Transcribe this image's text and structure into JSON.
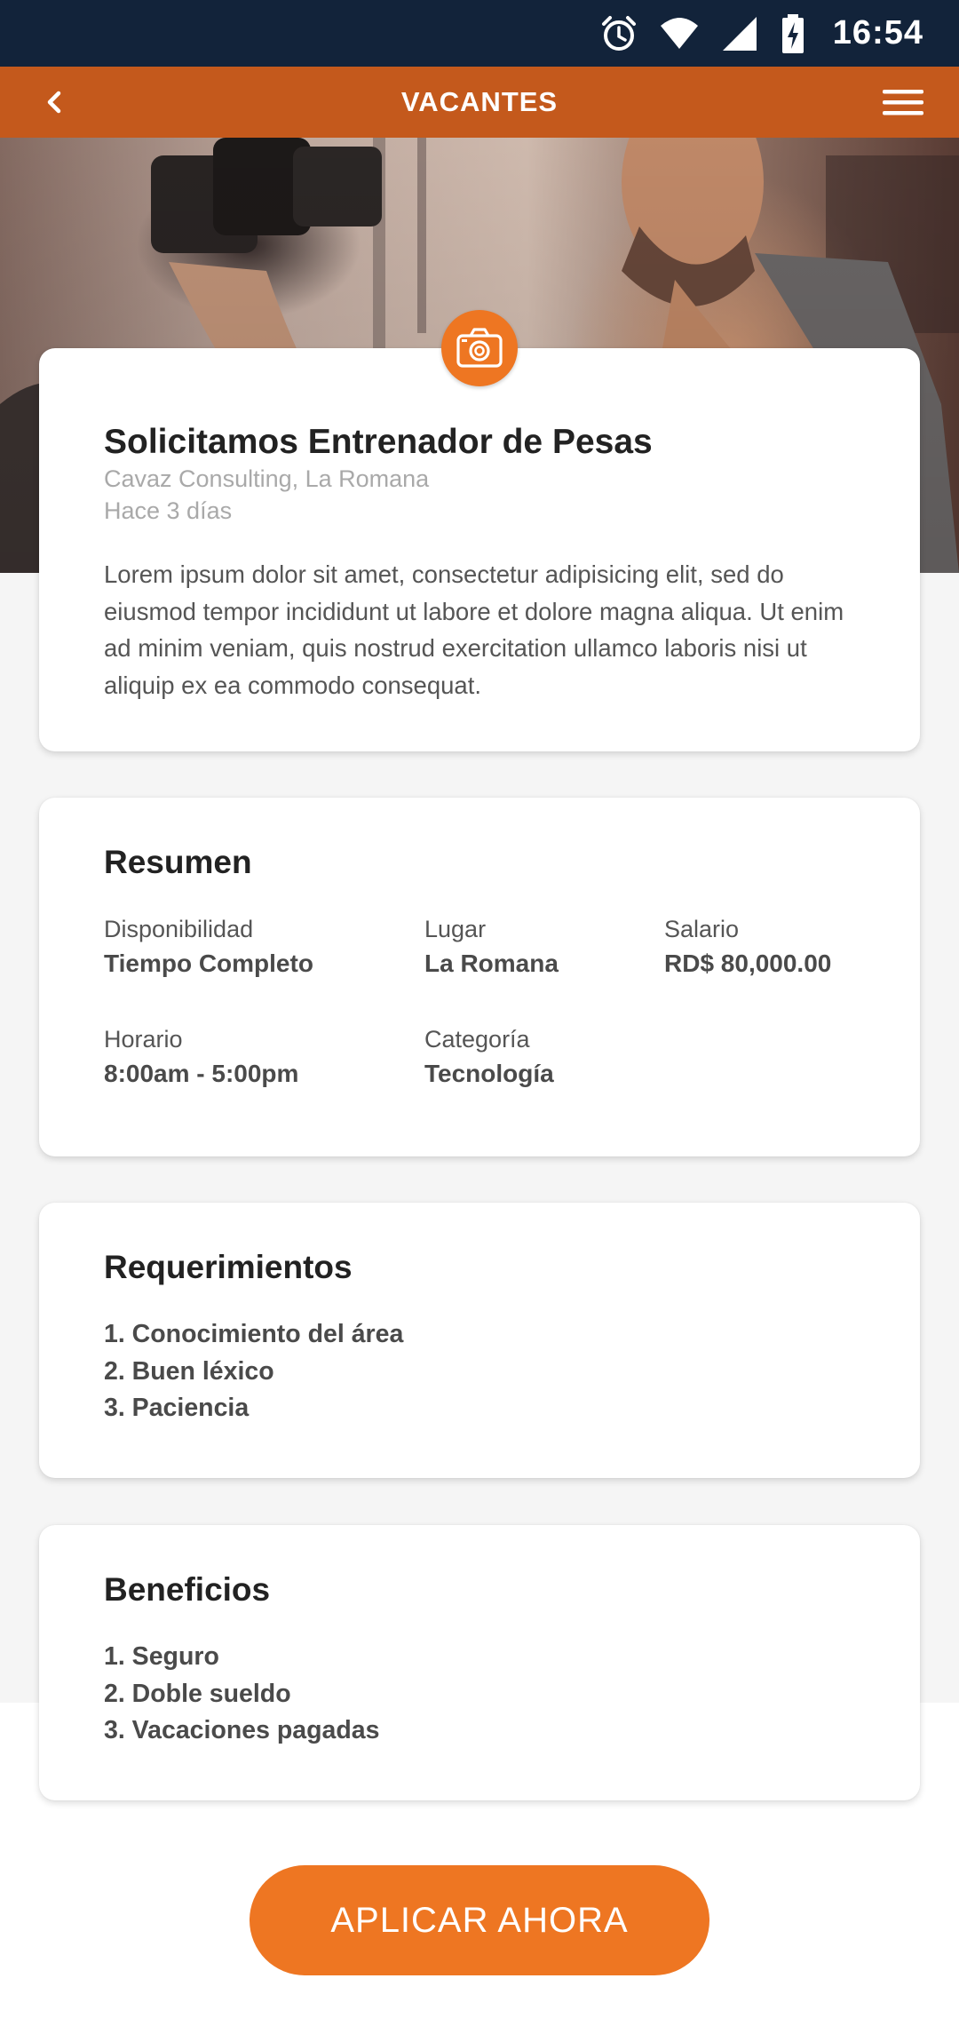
{
  "status_bar": {
    "time": "16:54"
  },
  "app_bar": {
    "title": "VACANTES"
  },
  "job": {
    "title": "Solicitamos Entrenador de Pesas",
    "company": "Cavaz Consulting, La Romana",
    "posted": "Hace 3 días",
    "description": "Lorem ipsum dolor sit amet, consectetur adipisicing elit, sed do eiusmod tempor incididunt ut labore et dolore magna aliqua. Ut enim ad minim veniam, quis nostrud exercitation ullamco laboris nisi ut aliquip ex ea commodo consequat."
  },
  "summary": {
    "title": "Resumen",
    "fields": [
      {
        "label": "Disponibilidad",
        "value": "Tiempo Completo"
      },
      {
        "label": "Lugar",
        "value": "La Romana"
      },
      {
        "label": "Salario",
        "value": "RD$ 80,000.00"
      },
      {
        "label": "Horario",
        "value": "8:00am - 5:00pm"
      },
      {
        "label": "Categoría",
        "value": "Tecnología"
      }
    ]
  },
  "requirements": {
    "title": "Requerimientos",
    "items": [
      "1. Conocimiento del área",
      "2. Buen léxico",
      "3. Paciencia"
    ]
  },
  "benefits": {
    "title": "Beneficios",
    "items": [
      "1. Seguro",
      "2. Doble sueldo",
      "3. Vacaciones pagadas"
    ]
  },
  "apply_button": {
    "label": "APLICAR AHORA"
  },
  "icons": {
    "status": [
      "alarm-icon",
      "wifi-icon",
      "cell-signal-icon",
      "battery-charging-icon"
    ],
    "app_bar": [
      "back-arrow-icon",
      "hamburger-menu-icon"
    ],
    "badge": "camera-icon"
  },
  "colors": {
    "status_bar": "#12233a",
    "app_bar": "#c4591c",
    "accent": "#ee7622",
    "page_background": "#f5f5f5"
  }
}
